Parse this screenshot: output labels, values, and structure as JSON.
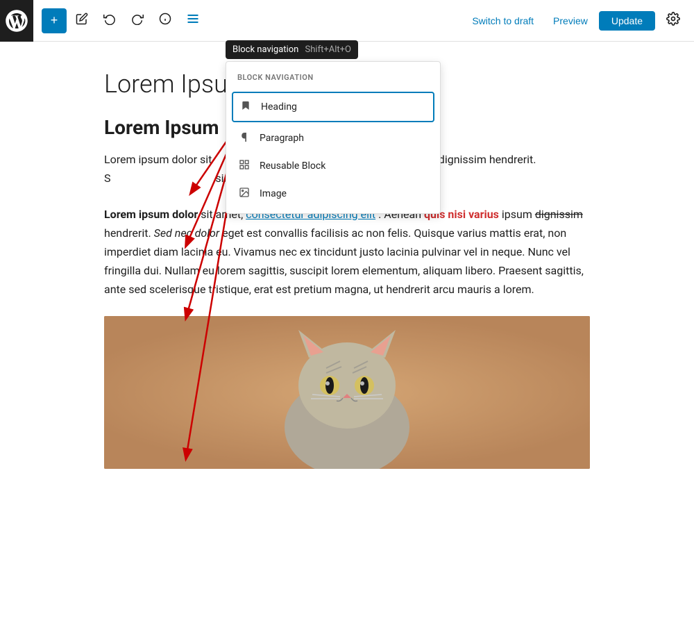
{
  "toolbar": {
    "add_label": "+",
    "switch_to_draft_label": "Switch to draft",
    "preview_label": "Preview",
    "update_label": "Update"
  },
  "tooltip": {
    "text": "Block navigation",
    "shortcut": "Shift+Alt+O"
  },
  "block_navigation": {
    "title": "BLOCK NAVIGATION",
    "items": [
      {
        "id": "heading",
        "label": "Heading",
        "icon": "bookmark"
      },
      {
        "id": "paragraph",
        "label": "Paragraph",
        "icon": "pilcrow"
      },
      {
        "id": "reusable",
        "label": "Reusable Block",
        "icon": "reusable"
      },
      {
        "id": "image",
        "label": "Image",
        "icon": "image"
      }
    ]
  },
  "editor": {
    "post_title": "Lorem Ipsum Do",
    "heading_text": "Lorem Ipsum",
    "paragraph_1_text": "Lorem ipsum dolor sit                                         Aenean quis nisi varius ipsum dignissim hendrerit. S                                             sis ac non felis.",
    "paragraph_2_parts": [
      {
        "text": "Lorem ipsum dolor",
        "style": "bold"
      },
      {
        "text": " sit amet, ",
        "style": "normal"
      },
      {
        "text": "consectetur adipiscing elit",
        "style": "link"
      },
      {
        "text": ". Aenean ",
        "style": "normal"
      },
      {
        "text": "quis nisi varius",
        "style": "bold-red"
      },
      {
        "text": " ipsum ",
        "style": "normal"
      },
      {
        "text": "dignissim",
        "style": "strikethrough"
      },
      {
        "text": " hendrerit. ",
        "style": "normal"
      },
      {
        "text": "Sed nec dolor",
        "style": "italic"
      },
      {
        "text": " eget est convallis facilisis ac non felis. Quisque varius mattis erat, non imperdiet diam lacinia eu. Vivamus nec ex tincidunt justo lacinia pulvinar vel in neque. Nunc vel fringilla dui. Nullam eu lorem sagittis, suscipit lorem elementum, aliquam libero. Praesent sagittis, ante sed scelerisque tristique, erat est pretium magna, ut hendrerit arcu mauris a lorem.",
        "style": "normal"
      }
    ]
  }
}
